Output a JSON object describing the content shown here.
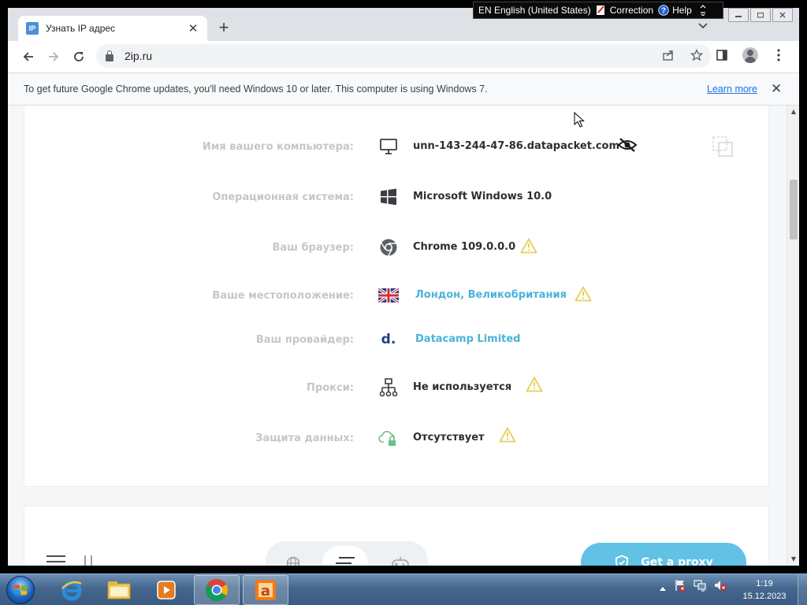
{
  "tab": {
    "favicon": "IP",
    "title": "Узнать IP адрес",
    "close": "✕"
  },
  "newtab": "+",
  "address": {
    "url": "2ip.ru"
  },
  "infobar": {
    "message": "To get future Google Chrome updates, you'll need Windows 10 or later. This computer is using Windows 7.",
    "learn_more": "Learn more",
    "close": "✕"
  },
  "rows": [
    {
      "label": "Имя вашего компьютера:",
      "value": "unn-143-244-47-86.datapacket.com",
      "icon": "monitor-icon",
      "link": false
    },
    {
      "label": "Операционная система:",
      "value": "Microsoft Windows 10.0",
      "icon": "windows-icon",
      "link": false
    },
    {
      "label": "Ваш браузер:",
      "value": "Chrome 109.0.0.0",
      "icon": "chrome-icon",
      "link": false
    },
    {
      "label": "Ваше местоположение:",
      "value": "Лондон, Великобритания",
      "icon": "uk-flag-icon",
      "link": true
    },
    {
      "label": "Ваш провайдер:",
      "value": "Datacamp Limited",
      "icon": "provider-logo-icon",
      "link": true
    },
    {
      "label": "Прокси:",
      "value": "Не используется",
      "icon": "network-icon",
      "link": false
    },
    {
      "label": "Защита данных:",
      "value": "Отсутствует",
      "icon": "cloud-lock-icon",
      "link": false
    }
  ],
  "provider_logo": "d.",
  "proxy_button": "Get a proxy",
  "langbar": {
    "language": "EN English (United States)",
    "correction": "Correction",
    "help": "Help"
  },
  "clock": {
    "time": "1:19",
    "date": "15.12.2023"
  },
  "colors": {
    "link": "#4bb3d8",
    "warning": "#e6cf5a",
    "proxy_button": "#61c2e6"
  }
}
